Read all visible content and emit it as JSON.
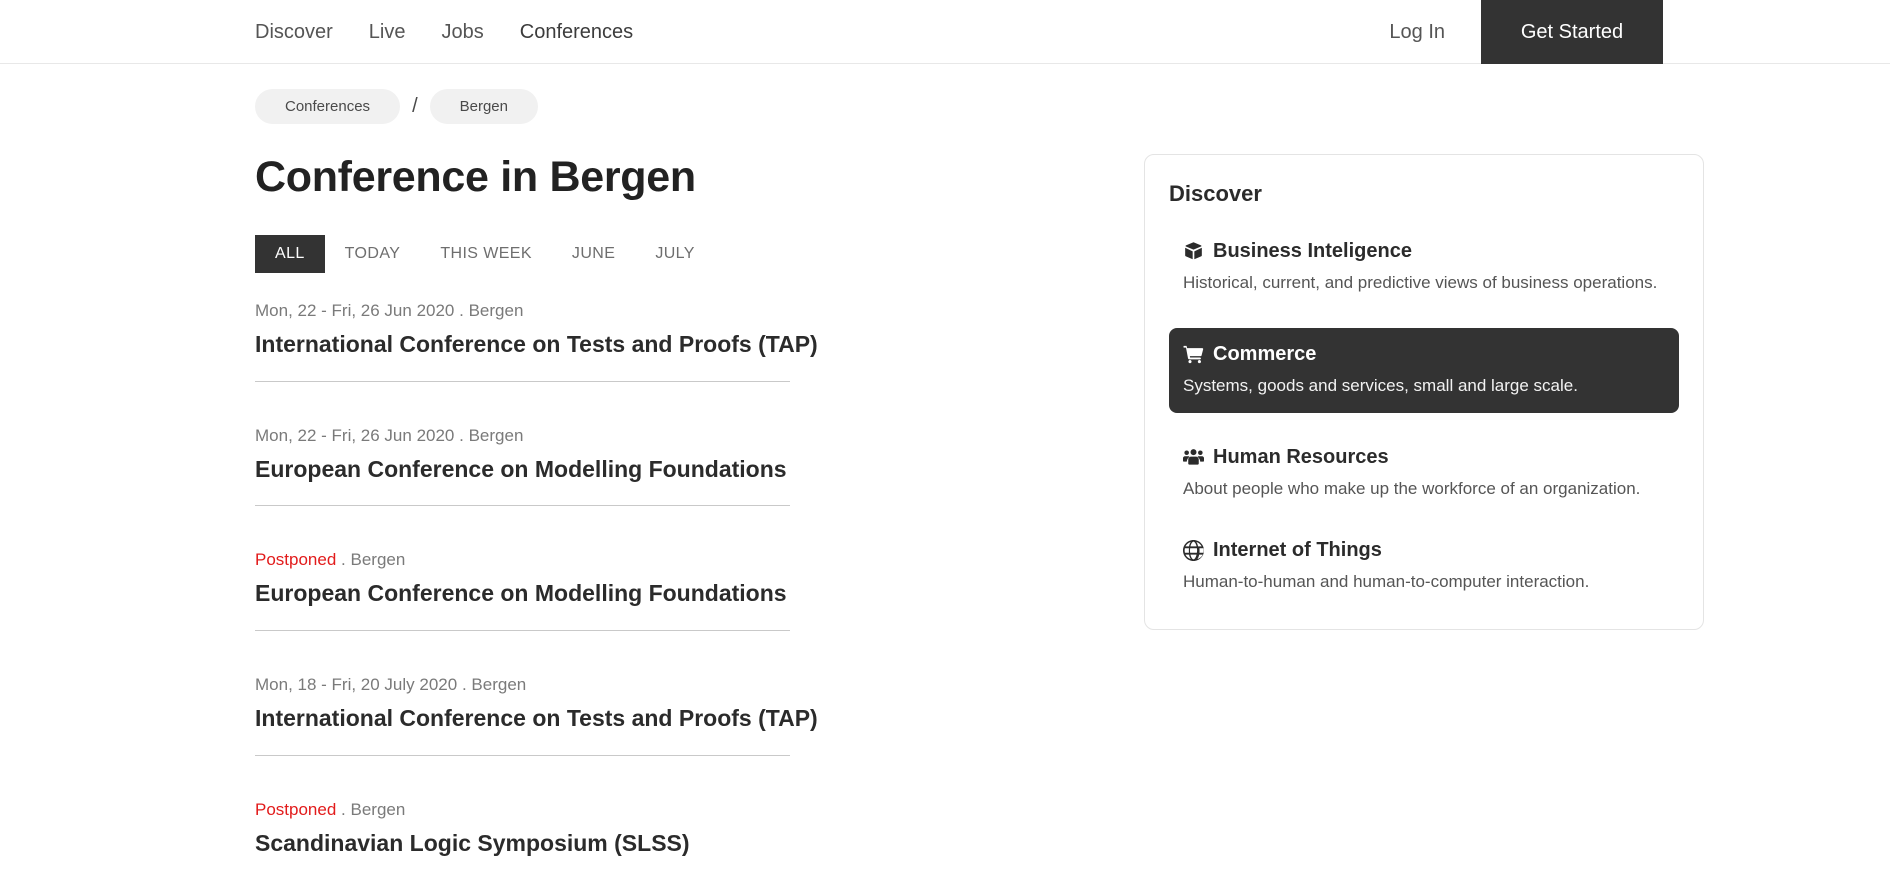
{
  "header": {
    "nav_links": [
      {
        "label": "Discover",
        "name": "nav-discover"
      },
      {
        "label": "Live",
        "name": "nav-live"
      },
      {
        "label": "Jobs",
        "name": "nav-jobs"
      },
      {
        "label": "Conferences",
        "name": "nav-conferences"
      }
    ],
    "login_label": "Log In",
    "get_started_label": "Get Started"
  },
  "breadcrumb": {
    "items": [
      {
        "label": "Conferences"
      },
      {
        "label": "Bergen"
      }
    ],
    "separator": "/"
  },
  "main": {
    "title": "Conference in Bergen",
    "filters": [
      {
        "label": "ALL",
        "active": true
      },
      {
        "label": "TODAY",
        "active": false
      },
      {
        "label": "THIS WEEK",
        "active": false
      },
      {
        "label": "JUNE",
        "active": false
      },
      {
        "label": "JULY",
        "active": false
      }
    ],
    "conferences": [
      {
        "date": "Mon, 22 - Fri, 26 Jun 2020",
        "postponed": false,
        "location": "Bergen",
        "separator": ".",
        "title": "International Conference on Tests and Proofs (TAP)"
      },
      {
        "date": "Mon, 22 - Fri, 26 Jun 2020",
        "postponed": false,
        "location": "Bergen",
        "separator": ".",
        "title": "European Conference on Modelling Foundations"
      },
      {
        "date": "Postponed",
        "postponed": true,
        "location": "Bergen",
        "separator": ".",
        "title": "European Conference on Modelling Foundations"
      },
      {
        "date": "Mon, 18 - Fri, 20 July 2020",
        "postponed": false,
        "location": "Bergen",
        "separator": ".",
        "title": "International Conference on Tests and Proofs (TAP)"
      },
      {
        "date": "Postponed",
        "postponed": true,
        "location": "Bergen",
        "separator": ".",
        "title": "Scandinavian Logic Symposium (SLSS)"
      }
    ]
  },
  "sidebar": {
    "heading": "Discover",
    "items": [
      {
        "title": "Business Inteligence",
        "desc": "Historical, current, and predictive views of business operations.",
        "icon": "box-icon",
        "active": false
      },
      {
        "title": "Commerce",
        "desc": "Systems, goods and services, small and large scale.",
        "icon": "shopping-cart-icon",
        "active": true
      },
      {
        "title": "Human Resources",
        "desc": "About people who make up the workforce of an organization.",
        "icon": "users-icon",
        "active": false
      },
      {
        "title": "Internet of Things",
        "desc": "Human-to-human and human-to-computer interaction.",
        "icon": "globe-icon",
        "active": false
      }
    ]
  },
  "colors": {
    "dark": "#333333",
    "postponed_red": "#e21b1b",
    "muted_text": "#7a7a7a",
    "pill_bg": "#f1f1f1"
  }
}
